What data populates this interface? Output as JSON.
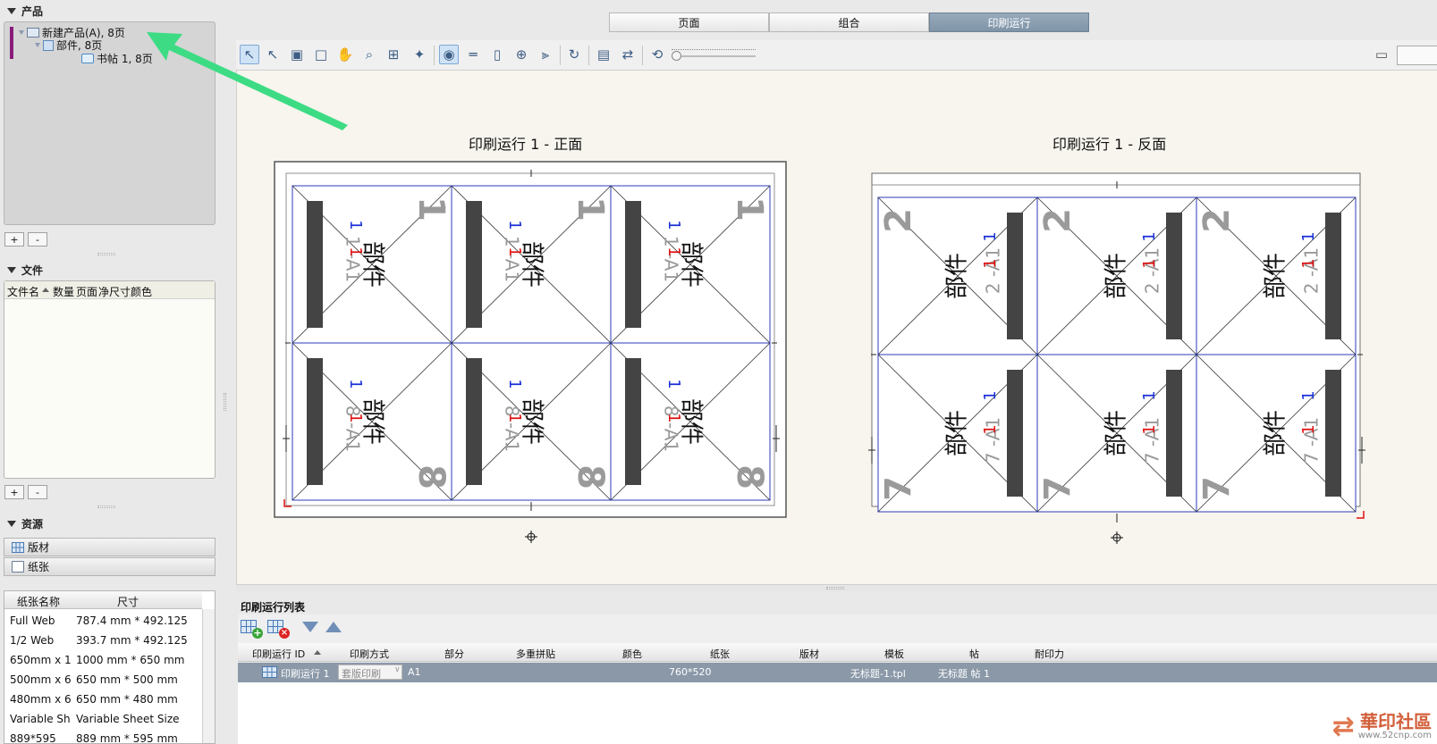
{
  "tabs": [
    {
      "label": "页面",
      "active": false
    },
    {
      "label": "组合",
      "active": false
    },
    {
      "label": "印刷运行",
      "active": true
    }
  ],
  "products": {
    "title": "产品",
    "tree": [
      {
        "label": "新建产品(A), 8页"
      },
      {
        "label": "部件, 8页"
      },
      {
        "label": "书帖 1, 8页"
      }
    ],
    "add": "+",
    "remove": "-"
  },
  "files": {
    "title": "文件",
    "columns": [
      "文件名",
      "数量",
      "页面",
      "净尺寸",
      "颜色"
    ],
    "add": "+",
    "remove": "-"
  },
  "resources": {
    "title": "资源",
    "items": [
      "版材",
      "纸张"
    ],
    "paper_table": {
      "columns": [
        "纸张名称",
        "尺寸"
      ],
      "rows": [
        {
          "name": "Full Web",
          "size": "787.4 mm * 492.125"
        },
        {
          "name": "1/2 Web",
          "size": "393.7 mm * 492.125"
        },
        {
          "name": "650mm x 1",
          "size": "1000 mm * 650 mm"
        },
        {
          "name": "500mm x 6",
          "size": "650 mm * 500 mm"
        },
        {
          "name": "480mm x 6",
          "size": "650 mm * 480 mm"
        },
        {
          "name": "Variable Sh",
          "size": "Variable Sheet Size"
        },
        {
          "name": "889*595",
          "size": "889 mm * 595 mm"
        }
      ]
    }
  },
  "toolbar": {
    "icons": [
      "pointer-icon",
      "select-icon",
      "page-select-icon",
      "sheet-icon",
      "hand-icon",
      "zoom-icon",
      "layout-icon",
      "wand-icon",
      "preview-icon",
      "ruler-icon",
      "page-icon",
      "crosshair-icon",
      "split-icon",
      "rotate-icon",
      "align-icon",
      "swap-icon",
      "refresh-icon"
    ],
    "zoom_level": 0.02
  },
  "sheets": {
    "front": {
      "title": "印刷运行 1 - 正面",
      "top_row": {
        "big": "1",
        "small": "1 -A1",
        "part": "部件",
        "red": "1",
        "blue": "1"
      },
      "bottom_row": {
        "big": "8",
        "small": "8 -A1",
        "part": "部件",
        "red": "1",
        "blue": "1"
      }
    },
    "back": {
      "title": "印刷运行 1 - 反面",
      "top_row": {
        "big": "2",
        "small": "2 -A1",
        "part": "部件",
        "red": "1",
        "blue": "1"
      },
      "bottom_row": {
        "big": "7",
        "small": "7 -A1",
        "part": "部件",
        "red": "1",
        "blue": "1"
      }
    }
  },
  "print_run_list": {
    "title": "印刷运行列表",
    "columns": [
      "印刷运行 ID",
      "印刷方式",
      "部分",
      "多重拼贴",
      "颜色",
      "纸张",
      "版材",
      "模板",
      "帖",
      "耐印力"
    ],
    "row": {
      "id": "印刷运行 1",
      "method": "套版印刷",
      "part": "A1",
      "paper": "760*520",
      "template": "无标题-1.tpl",
      "signature": "无标题 帖 1"
    }
  },
  "watermark": {
    "text": "華印社區",
    "url": "www.52cnp.com"
  },
  "colors": {
    "accent_tab": "#8a9fb3",
    "arrow_green": "#3ddc84",
    "cell_blue": "#2b3bb8",
    "spine": "#444444",
    "red_mark": "#e01010",
    "blue_mark": "#1a2fd6"
  }
}
